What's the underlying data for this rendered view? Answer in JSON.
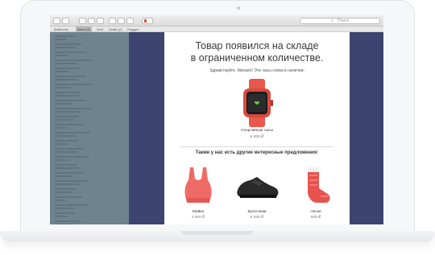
{
  "browser": {
    "search_placeholder": "Поиск",
    "favorites": [
      "Mailboxes",
      "Inbox (3)",
      "Sent",
      "Drafts (2)",
      "Flagged"
    ]
  },
  "email": {
    "headline_line1": "Товар появился на складе",
    "headline_line2": "в ограниченном количестве.",
    "greeting": "Здравствуйте, Михаил! Эти часы снова в наличии:",
    "featured": {
      "name": "Спортивные часы",
      "price": "6 800 ₽",
      "icon": "fitness-watch-icon",
      "color": "#e9584d"
    },
    "offers_title": "Также у нас есть другие интересные предложения:",
    "offers": [
      {
        "name": "Майка",
        "price": "2 900 ₽",
        "icon": "sports-top-icon",
        "color": "#ee6a64"
      },
      {
        "name": "Кроссовки",
        "price": "5 000 ₽",
        "icon": "sneaker-icon",
        "color": "#2a2a2a"
      },
      {
        "name": "Носки",
        "price": "900 ₽",
        "icon": "socks-icon",
        "color": "#e8534f"
      }
    ]
  },
  "colors": {
    "screen_background": "#3d4470",
    "message_list": "#6f8290",
    "accent_red": "#e9584d"
  }
}
